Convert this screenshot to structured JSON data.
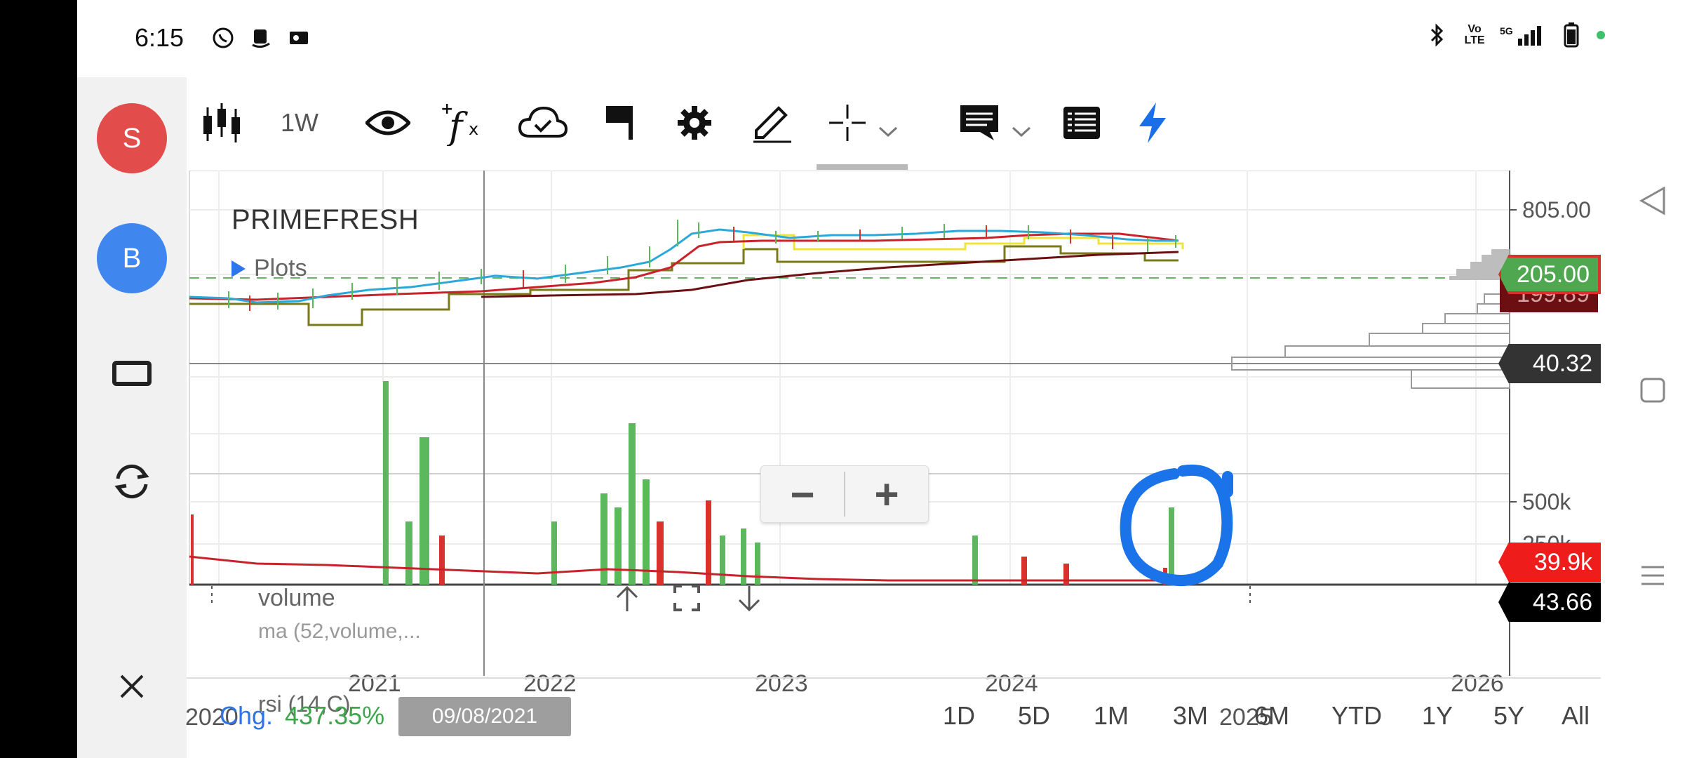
{
  "status": {
    "time": "6:15",
    "left_icons": [
      "whatsapp-icon",
      "amazon-icon",
      "photo-icon"
    ],
    "right_icons": [
      "bluetooth-icon",
      "volte-icon",
      "5g-signal-icon",
      "battery-icon"
    ]
  },
  "sidebar": {
    "avatars": [
      {
        "letter": "S",
        "color": "#e24c4b"
      },
      {
        "letter": "B",
        "color": "#3f86ef"
      }
    ],
    "icons": [
      "window-icon",
      "refresh-icon",
      "close-icon"
    ]
  },
  "toolbar": {
    "interval": "1W",
    "items": [
      "candlestick-icon",
      "eye-icon",
      "function-icon",
      "cloud-icon",
      "flag-icon",
      "gear-icon",
      "pencil-icon",
      "crosshair-icon",
      "comment-icon",
      "list-icon",
      "lightning-icon"
    ]
  },
  "chart": {
    "symbol": "PRIMEFRESH",
    "plots_label": "Plots",
    "volume_label": "volume",
    "ma_label": "ma (52,volume,...",
    "rsi_label": "rsi (14,C)",
    "crosshair_date": "09/08/2021",
    "price_axis": [
      "805.00"
    ],
    "volume_axis": [
      "500k",
      "250k"
    ],
    "tags": {
      "last_price": "205.00",
      "last_price_hidden": "199.89",
      "crosshair_price": "40.32",
      "volume": "39.9k",
      "rsi": "43.66"
    },
    "years_top": [
      "2021",
      "2022",
      "2023",
      "2024"
    ],
    "years_bottom": [
      "2020",
      "2025",
      "2026"
    ],
    "zoom_out": "−",
    "zoom_in": "+",
    "colors": {
      "up": "#5cb85c",
      "down": "#d9312b",
      "ma_fast": "#2ca8d8",
      "ma_mid": "#c8232a",
      "ma_slow": "#6b0f12",
      "step": "#7a7a18",
      "highlight": "#1a73e8"
    }
  },
  "bottom": {
    "chg_label": "Chg.",
    "chg_value": "437.35%",
    "ranges": [
      "1D",
      "5D",
      "1M",
      "3M",
      "6M",
      "YTD",
      "1Y",
      "5Y",
      "All"
    ]
  },
  "sysnav": {
    "icons": [
      "back-icon",
      "home-icon",
      "menu-icon"
    ]
  }
}
